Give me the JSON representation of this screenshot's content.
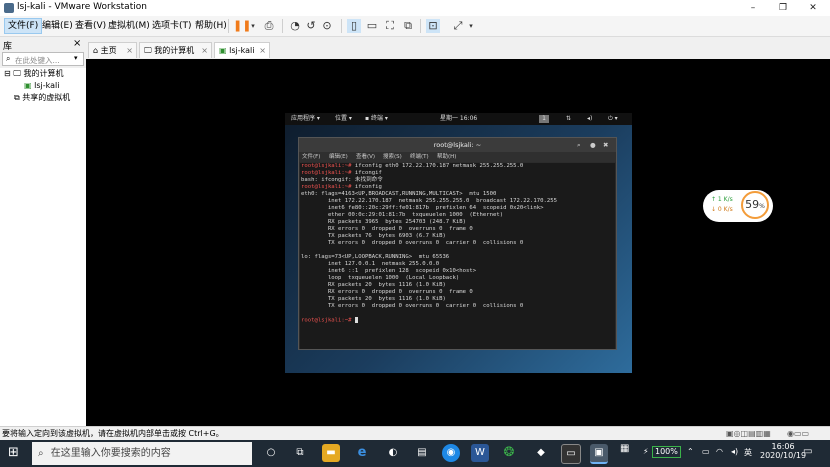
{
  "window": {
    "title": "lsj-kali - VMware Workstation",
    "buttons": [
      "–",
      "❐",
      "✕"
    ]
  },
  "menu": {
    "items": [
      "文件(F)",
      "编辑(E)",
      "查看(V)",
      "虚拟机(M)",
      "选项卡(T)",
      "帮助(H)"
    ]
  },
  "library": {
    "label": "库",
    "close": "×",
    "search_placeholder": "在此处键入...",
    "tree": {
      "root": "我的计算机",
      "vm": "lsj-kali",
      "shared": "共享的虚拟机"
    }
  },
  "tabs": [
    {
      "label": "主页",
      "close": "×"
    },
    {
      "label": "我的计算机",
      "close": "×"
    },
    {
      "label": "lsj-kali",
      "close": "×"
    }
  ],
  "guest": {
    "topbar": {
      "apps": "应用程序 ▾",
      "places": "位置 ▾",
      "terminal": "终端 ▾",
      "clock": "星期一 16:06",
      "workspace": "1"
    },
    "terminal": {
      "title": "root@lsjkali: ~",
      "menu": [
        "文件(F)",
        "编辑(E)",
        "查看(V)",
        "搜索(S)",
        "终端(T)",
        "帮助(H)"
      ],
      "lines": [
        {
          "prompt": "root@lsjkali:~# ",
          "text": "ifconfig eth0 172.22.170.187 netmask 255.255.255.0"
        },
        {
          "prompt": "root@lsjkali:~# ",
          "text": "ifcongif"
        },
        {
          "prompt": "",
          "text": "bash: ifcongif: 未找到命令"
        },
        {
          "prompt": "root@lsjkali:~# ",
          "text": "ifconfig"
        },
        {
          "prompt": "",
          "text": "eth0: flags=4163<UP,BROADCAST,RUNNING,MULTICAST>  mtu 1500"
        },
        {
          "prompt": "",
          "text": "        inet 172.22.170.187  netmask 255.255.255.0  broadcast 172.22.170.255"
        },
        {
          "prompt": "",
          "text": "        inet6 fe80::20c:29ff:fe01:817b  prefixlen 64  scopeid 0x20<link>"
        },
        {
          "prompt": "",
          "text": "        ether 00:0c:29:01:81:7b  txqueuelen 1000  (Ethernet)"
        },
        {
          "prompt": "",
          "text": "        RX packets 3965  bytes 254703 (248.7 KiB)"
        },
        {
          "prompt": "",
          "text": "        RX errors 0  dropped 0  overruns 0  frame 0"
        },
        {
          "prompt": "",
          "text": "        TX packets 76  bytes 6903 (6.7 KiB)"
        },
        {
          "prompt": "",
          "text": "        TX errors 0  dropped 0 overruns 0  carrier 0  collisions 0"
        },
        {
          "prompt": "",
          "text": ""
        },
        {
          "prompt": "",
          "text": "lo: flags=73<UP,LOOPBACK,RUNNING>  mtu 65536"
        },
        {
          "prompt": "",
          "text": "        inet 127.0.0.1  netmask 255.0.0.0"
        },
        {
          "prompt": "",
          "text": "        inet6 ::1  prefixlen 128  scopeid 0x10<host>"
        },
        {
          "prompt": "",
          "text": "        loop  txqueuelen 1000  (Local Loopback)"
        },
        {
          "prompt": "",
          "text": "        RX packets 20  bytes 1116 (1.0 KiB)"
        },
        {
          "prompt": "",
          "text": "        RX errors 0  dropped 0  overruns 0  frame 0"
        },
        {
          "prompt": "",
          "text": "        TX packets 20  bytes 1116 (1.0 KiB)"
        },
        {
          "prompt": "",
          "text": "        TX errors 0  dropped 0 overruns 0  carrier 0  collisions 0"
        },
        {
          "prompt": "",
          "text": ""
        },
        {
          "prompt": "root@lsjkali:~# ",
          "text": ""
        }
      ]
    }
  },
  "speed_widget": {
    "up": "↑ 1  K/s",
    "down": "↓ 0  K/s",
    "percent": "59",
    "percent_sign": "%"
  },
  "statusbar": {
    "text": "要将输入定向到该虚拟机，请在虚拟机内部单击或按 Ctrl+G。"
  },
  "taskbar": {
    "search_placeholder": "在这里输入你要搜索的内容",
    "battery": "100%",
    "ime": "英",
    "time": "16:06",
    "date": "2020/10/19"
  },
  "colors": {
    "accent": "#f39c3a",
    "prompt": "#ef5350",
    "taskbar": "#1f2a35"
  }
}
